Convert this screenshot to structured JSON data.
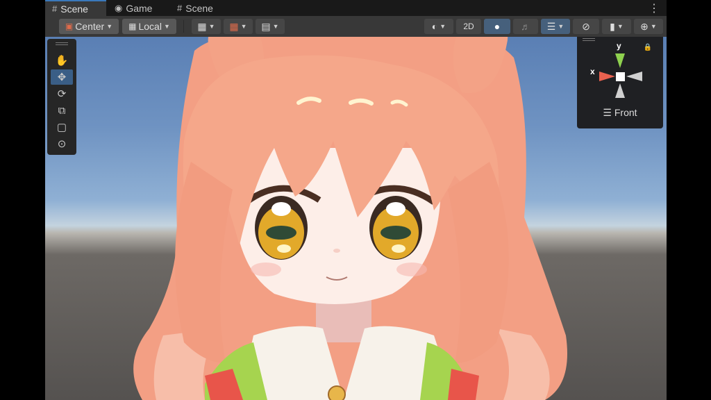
{
  "tabs": [
    {
      "label": "Scene",
      "icon": "grid-icon",
      "active": true
    },
    {
      "label": "Game",
      "icon": "gamepad-icon",
      "active": false
    },
    {
      "label": "Scene",
      "icon": "grid-icon",
      "active": false
    }
  ],
  "toolbar": {
    "pivot_label": "Center",
    "space_label": "Local",
    "mode_2d_label": "2D"
  },
  "tools": [
    "hand-icon",
    "move-icon",
    "rotate-icon",
    "scale-icon",
    "rect-icon",
    "transform-icon"
  ],
  "gizmo": {
    "y_label": "y",
    "x_label": "x",
    "view_label": "Front",
    "colors": {
      "y": "#8fd14f",
      "x": "#e8614f",
      "neutral": "#d0d0d0"
    }
  },
  "colors": {
    "accent_blue": "#3a79bb",
    "hair": "#f5a78a",
    "eye_gold": "#e2a92a",
    "skin": "#fdeee8",
    "sky_top": "#5a7fb4"
  }
}
